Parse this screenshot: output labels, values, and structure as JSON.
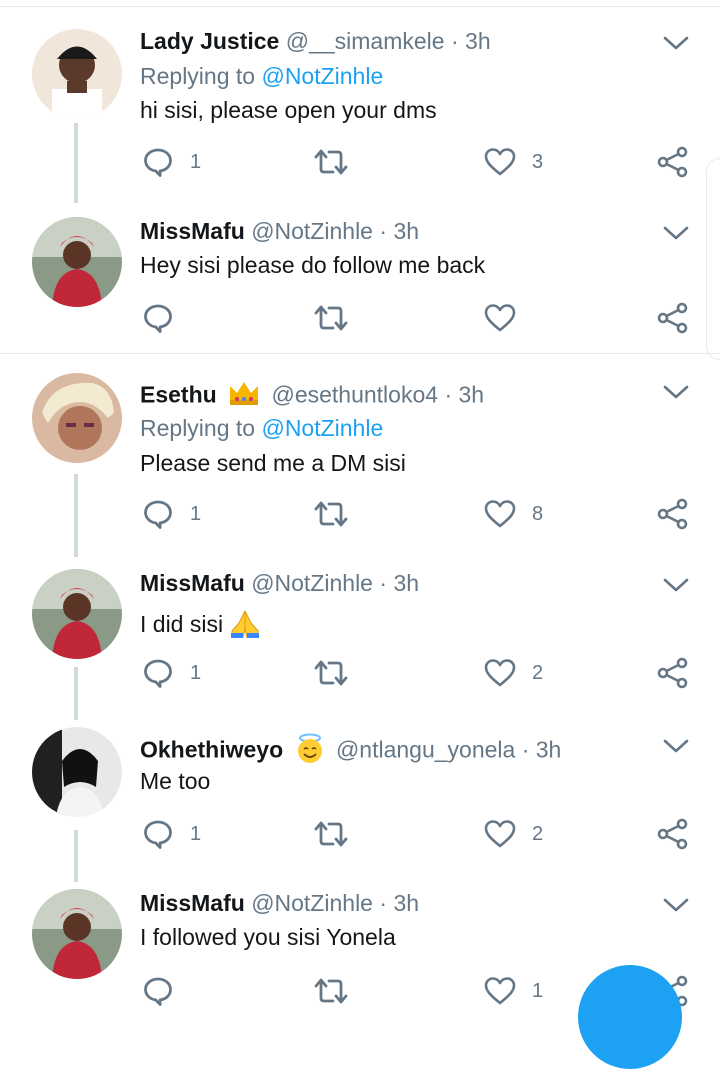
{
  "tweets": [
    {
      "name": "Lady Justice",
      "handle": "@__simamkele",
      "dot": "·",
      "time": "3h",
      "replying_prefix": "Replying to ",
      "replying_to": "@NotZinhle",
      "text": "hi sisi, please open your dms",
      "replies": "1",
      "retweets": "",
      "likes": "3",
      "name_emoji": ""
    },
    {
      "name": "MissMafu",
      "handle": "@NotZinhle",
      "dot": "·",
      "time": "3h",
      "replying_prefix": "",
      "replying_to": "",
      "text": "Hey sisi please do follow me back",
      "replies": "",
      "retweets": "",
      "likes": "",
      "name_emoji": ""
    },
    {
      "name": "Esethu",
      "handle": "@esethuntloko4",
      "dot": "·",
      "time": "3h",
      "replying_prefix": "Replying to ",
      "replying_to": "@NotZinhle",
      "text": "Please send me a DM sisi",
      "replies": "1",
      "retweets": "",
      "likes": "8",
      "name_emoji": "crown-emoji"
    },
    {
      "name": "MissMafu",
      "handle": "@NotZinhle",
      "dot": "·",
      "time": "3h",
      "replying_prefix": "",
      "replying_to": "",
      "text": "I did sisi",
      "replies": "1",
      "retweets": "",
      "likes": "2",
      "name_emoji": "",
      "text_emoji": "folded-hands-emoji"
    },
    {
      "name": "Okhethiweyo",
      "handle": "@ntlangu_yonela",
      "dot": "·",
      "time": "3h",
      "replying_prefix": "",
      "replying_to": "",
      "text": "Me too",
      "replies": "1",
      "retweets": "",
      "likes": "2",
      "name_emoji": "smiling-halo-emoji"
    },
    {
      "name": "MissMafu",
      "handle": "@NotZinhle",
      "dot": "·",
      "time": "3h",
      "replying_prefix": "",
      "replying_to": "",
      "text": "I followed you sisi Yonela",
      "replies": "",
      "retweets": "",
      "likes": "1",
      "name_emoji": ""
    }
  ],
  "colors": {
    "accent": "#1da1f2",
    "secondary_text": "#657786",
    "primary_text": "#14171a",
    "divider": "#e6ecf0",
    "thread_line": "#cfd9de"
  },
  "icons": {
    "reply": "reply-icon",
    "retweet": "retweet-icon",
    "like": "heart-icon",
    "share": "share-icon",
    "menu": "chevron-down-icon",
    "compose": "compose-fab"
  }
}
